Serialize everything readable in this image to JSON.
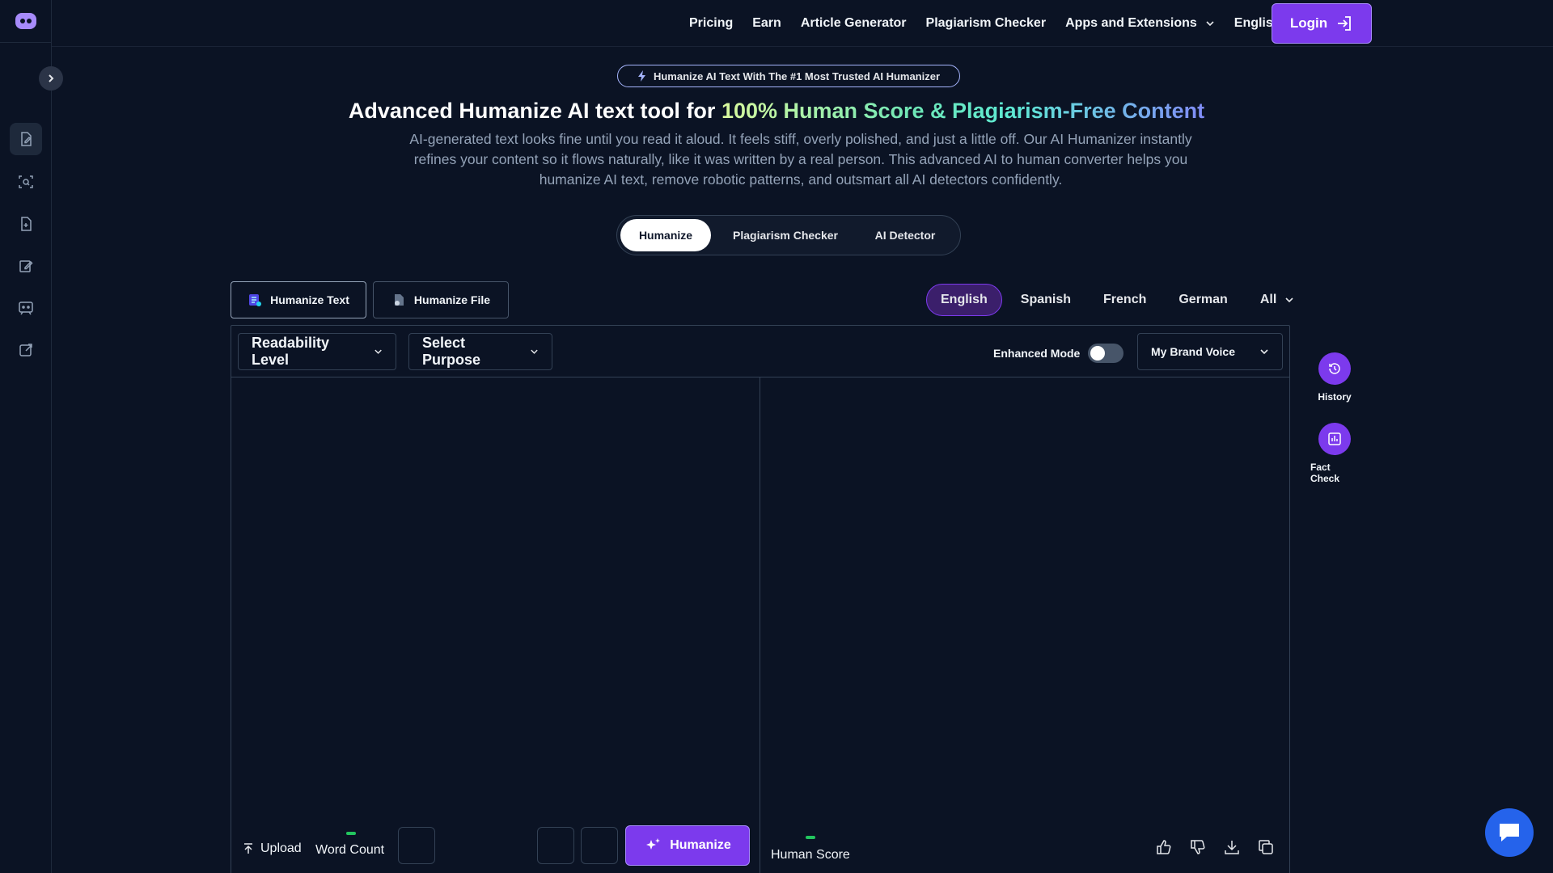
{
  "nav": {
    "links": [
      "Pricing",
      "Earn",
      "Article Generator",
      "Plagiarism Checker",
      "Apps and Extensions"
    ],
    "language": "English",
    "login_label": "Login"
  },
  "hero": {
    "badge": "Humanize AI Text With The #1 Most Trusted AI Humanizer",
    "headline_plain": "Advanced Humanize AI text tool for ",
    "headline_highlight": "100% Human Score & Plagiarism-Free Content",
    "subtext": "AI-generated text looks fine until you read it aloud. It feels stiff, overly polished, and just a little off. Our AI Humanizer instantly refines your content so it flows naturally, like it was written by a real person. This advanced AI to human converter helps you humanize AI text, remove robotic patterns, and outsmart all AI detectors confidently."
  },
  "mode_tabs": [
    "Humanize",
    "Plagiarism Checker",
    "AI Detector"
  ],
  "type_tabs": [
    "Humanize Text",
    "Humanize File"
  ],
  "languages": [
    "English",
    "Spanish",
    "French",
    "German",
    "All"
  ],
  "toolbar": {
    "readability": "Readability Level",
    "purpose": "Select Purpose",
    "enhanced_mode": "Enhanced Mode",
    "brand_voice": "My Brand Voice"
  },
  "input": {
    "upload": "Upload",
    "word_count": "Word Count",
    "humanize_button": "Humanize"
  },
  "output": {
    "human_score": "Human Score"
  },
  "side_tools": [
    "History",
    "Fact Check"
  ],
  "colors": {
    "accent": "#7c3aed",
    "background": "#0b1324",
    "border": "#334155"
  }
}
